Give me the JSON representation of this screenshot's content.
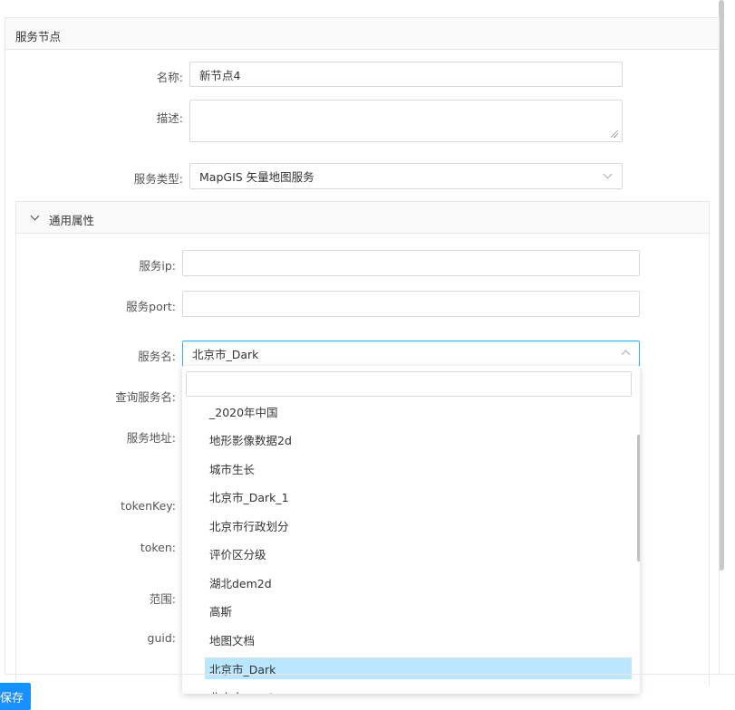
{
  "panel": {
    "title": "服务节点"
  },
  "form": {
    "name_label": "名称:",
    "name_value": "新节点4",
    "desc_label": "描述:",
    "desc_value": "",
    "type_label": "服务类型:",
    "type_value": "MapGIS 矢量地图服务"
  },
  "common": {
    "title": "通用属性",
    "ip_label": "服务ip:",
    "ip_value": "",
    "port_label": "服务port:",
    "port_value": "",
    "service_name_label": "服务名:",
    "service_name_value": "北京市_Dark",
    "query_name_label": "查询服务名:",
    "address_label": "服务地址:",
    "tokenkey_label": "tokenKey:",
    "token_label": "token:",
    "range_label": "范围:",
    "guid_label": "guid:"
  },
  "dropdown": {
    "search_value": "",
    "items": [
      "_2020年中国",
      "地形影像数据2d",
      "城市生长",
      "北京市_Dark_1",
      "北京市行政划分",
      "评价区分级",
      "湖北dem2d",
      "高斯",
      "地图文档",
      "北京市_Dark",
      "北京市_Dark"
    ],
    "selected_index": 9
  },
  "footer": {
    "save_label": "保存"
  },
  "colors": {
    "primary": "#1890ff",
    "selected_bg": "#bae7ff",
    "focus_border": "#40a9ff"
  }
}
